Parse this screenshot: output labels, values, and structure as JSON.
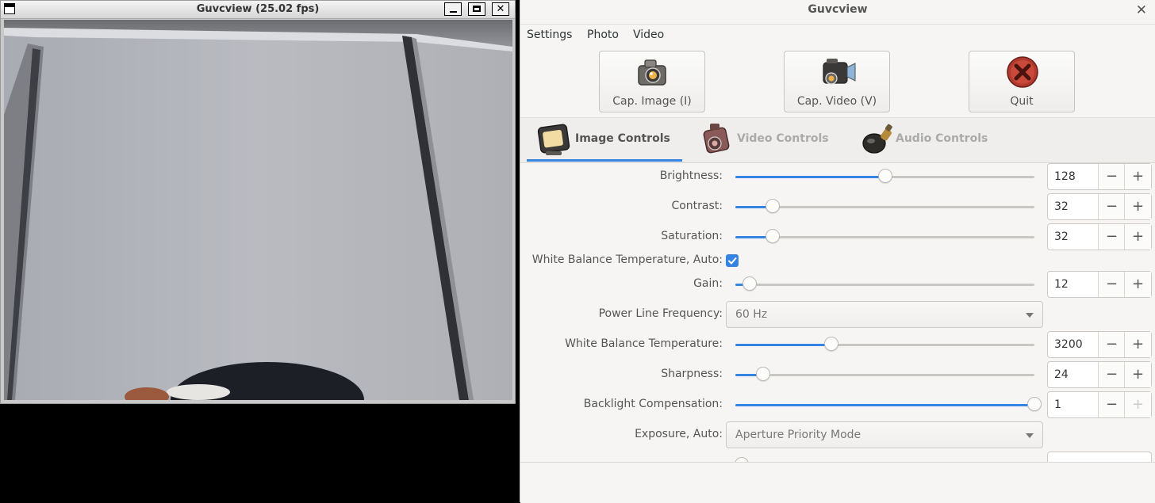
{
  "video_window": {
    "title": "Guvcview  (25.02 fps)",
    "buttons": {
      "close_glyph": "✕"
    }
  },
  "controls_window": {
    "title": "Guvcview",
    "close_glyph": "✕",
    "menu": [
      "Settings",
      "Photo",
      "Video"
    ],
    "toolbar": {
      "cap_image": "Cap. Image (I)",
      "cap_video": "Cap. Video (V)",
      "quit": "Quit"
    },
    "tabs": {
      "image": "Image Controls",
      "video": "Video Controls",
      "audio": "Audio Controls",
      "active": "image"
    },
    "controls": {
      "brightness": {
        "label": "Brightness:",
        "value": "128",
        "fraction": 0.5
      },
      "contrast": {
        "label": "Contrast:",
        "value": "32",
        "fraction": 0.125
      },
      "saturation": {
        "label": "Saturation:",
        "value": "32",
        "fraction": 0.125
      },
      "wb_auto": {
        "label": "White Balance Temperature, Auto:",
        "checked": true
      },
      "gain": {
        "label": "Gain:",
        "value": "12",
        "fraction": 0.047
      },
      "power_line": {
        "label": "Power Line Frequency:",
        "value": "60 Hz"
      },
      "wb_temp": {
        "label": "White Balance Temperature:",
        "value": "3200",
        "fraction": 0.32
      },
      "sharpness": {
        "label": "Sharpness:",
        "value": "24",
        "fraction": 0.094
      },
      "backlight": {
        "label": "Backlight Compensation:",
        "value": "1",
        "fraction": 1.0
      },
      "exposure_auto": {
        "label": "Exposure, Auto:",
        "value": "Aperture Priority Mode"
      }
    },
    "spin_glyphs": {
      "minus": "−",
      "plus": "+"
    },
    "colors": {
      "accent": "#3584e4",
      "quit_red": "#b13a2e"
    }
  }
}
